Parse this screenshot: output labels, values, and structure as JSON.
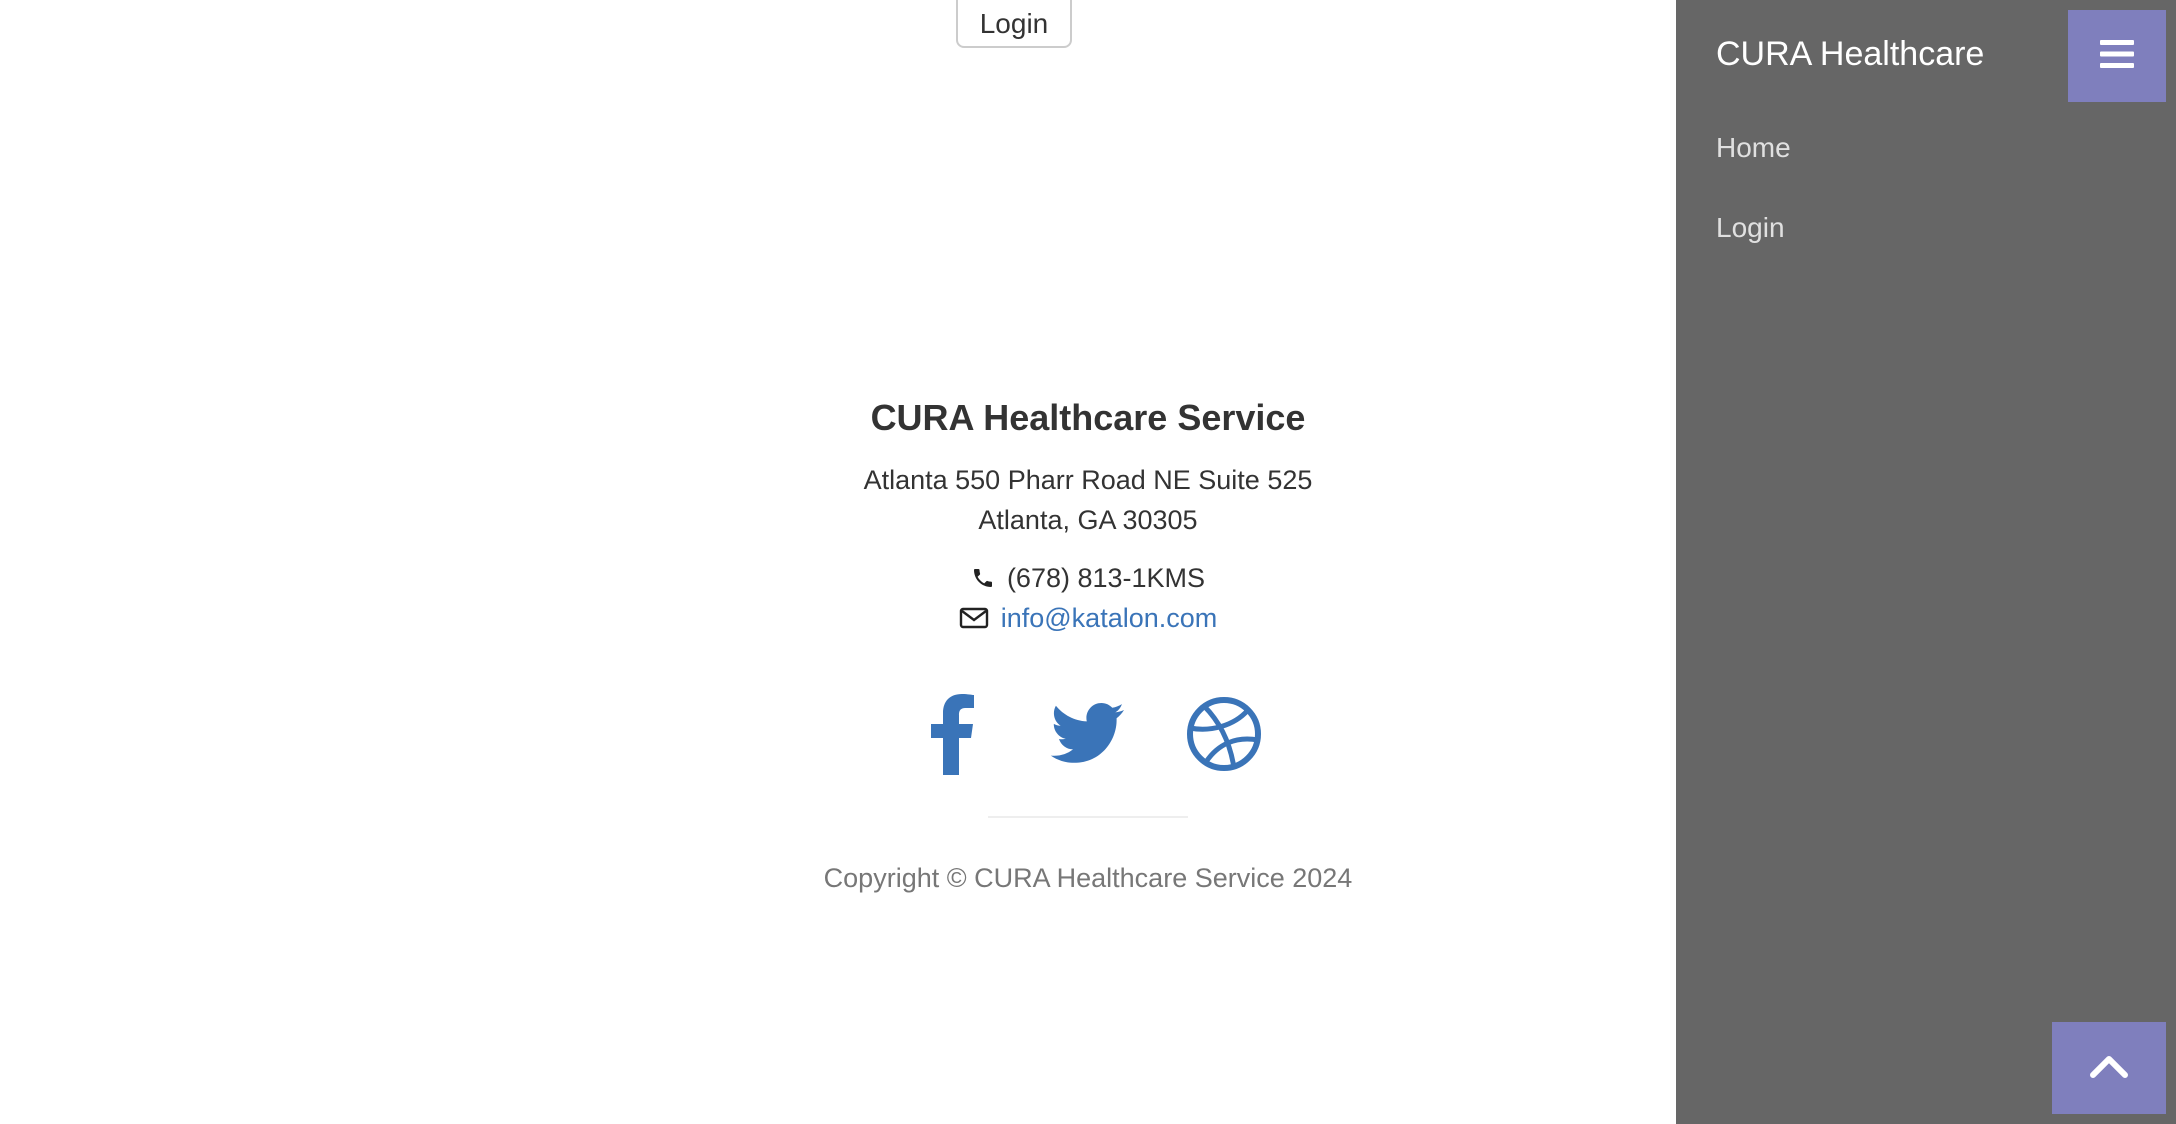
{
  "main": {
    "login_button": "Login"
  },
  "footer": {
    "title": "CURA Healthcare Service",
    "address_line1": "Atlanta 550 Pharr Road NE Suite 525",
    "address_line2": "Atlanta, GA 30305",
    "phone": "(678) 813-1KMS",
    "email": "info@katalon.com",
    "social": [
      "facebook-icon",
      "twitter-icon",
      "dribbble-icon"
    ],
    "copyright": "Copyright © CURA Healthcare Service 2024"
  },
  "sidebar": {
    "brand": "CURA Healthcare",
    "items": [
      {
        "label": "Home"
      },
      {
        "label": "Login"
      }
    ]
  },
  "colors": {
    "accent": "#7f7fbd",
    "sidebar_bg": "#666666",
    "link": "#3a74b8",
    "social": "#3a74b8"
  }
}
